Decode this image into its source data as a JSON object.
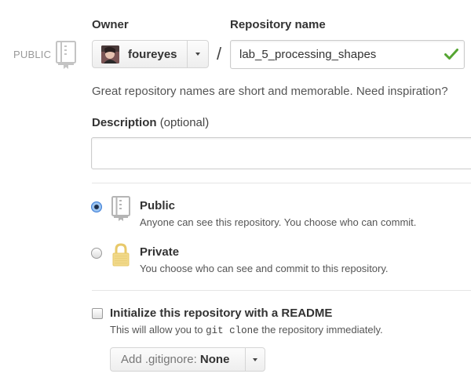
{
  "visibility_tag": "PUBLIC",
  "owner": {
    "label": "Owner",
    "name": "foureyes"
  },
  "repository": {
    "label": "Repository name",
    "value": "lab_5_processing_shapes",
    "separator": "/",
    "valid": true
  },
  "hint": "Great repository names are short and memorable. Need inspiration?",
  "description": {
    "label": "Description",
    "optional": "(optional)",
    "value": ""
  },
  "visibility": {
    "options": [
      {
        "title": "Public",
        "subtitle": "Anyone can see this repository. You choose who can commit.",
        "selected": true,
        "icon": "repo-book-icon"
      },
      {
        "title": "Private",
        "subtitle": "You choose who can see and commit to this repository.",
        "selected": false,
        "icon": "lock-icon"
      }
    ]
  },
  "readme": {
    "label": "Initialize this repository with a README",
    "sub_before": "This will allow you to",
    "sub_code": "git clone",
    "sub_after": "the repository immediately.",
    "checked": false
  },
  "gitignore": {
    "prefix": "Add .gitignore:",
    "value": "None"
  },
  "colors": {
    "valid_check": "#55a532",
    "radio_selected": "#3e7ed6",
    "lock_icon": "#e8c96a"
  }
}
